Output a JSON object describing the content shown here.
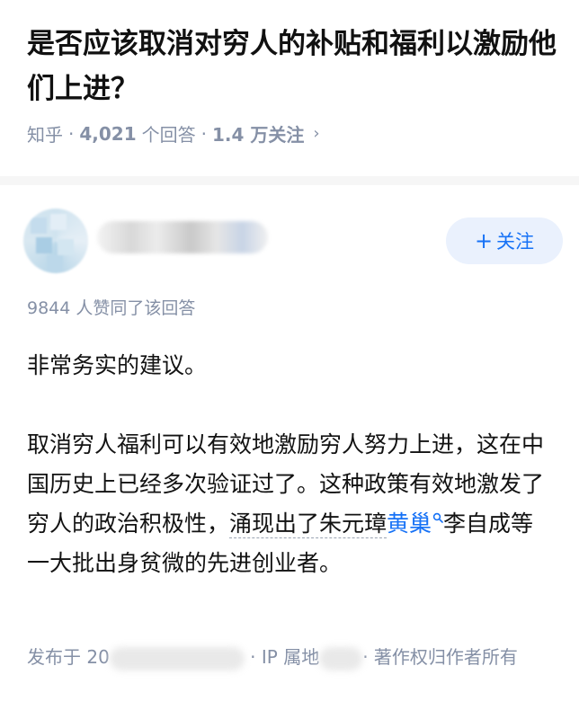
{
  "question": {
    "title": "是否应该取消对穷人的补贴和福利以激励他们上进？",
    "source": "知乎",
    "sep": "·",
    "answer_count": "4,021",
    "answer_count_suffix": "个回答",
    "follow_count": "1.4 万关注",
    "chevron": "›"
  },
  "author": {
    "follow_button": "关注",
    "follow_plus": "+"
  },
  "answer": {
    "votes_text": "9844 人赞同了该回答",
    "para1": "非常务实的建议。",
    "para2_a": "取消穷人福利可以有效地激励穷人努力上进，这在中国历史上已经多次验证过了。这种政策有效地激发了穷人的政治积极性，",
    "para2_link": "涌现出了朱元璋",
    "para2_kw": "黄巢",
    "para2_b": "李自成等一大批出身贫微的先进创业者。"
  },
  "footer": {
    "published_prefix": "发布于 20",
    "ip_label": "· IP 属地",
    "copyright": "· 著作权归作者所有"
  },
  "colors": {
    "accent": "#1772f6",
    "meta_gray": "#8590a6",
    "follow_bg": "#eaf1fd"
  }
}
